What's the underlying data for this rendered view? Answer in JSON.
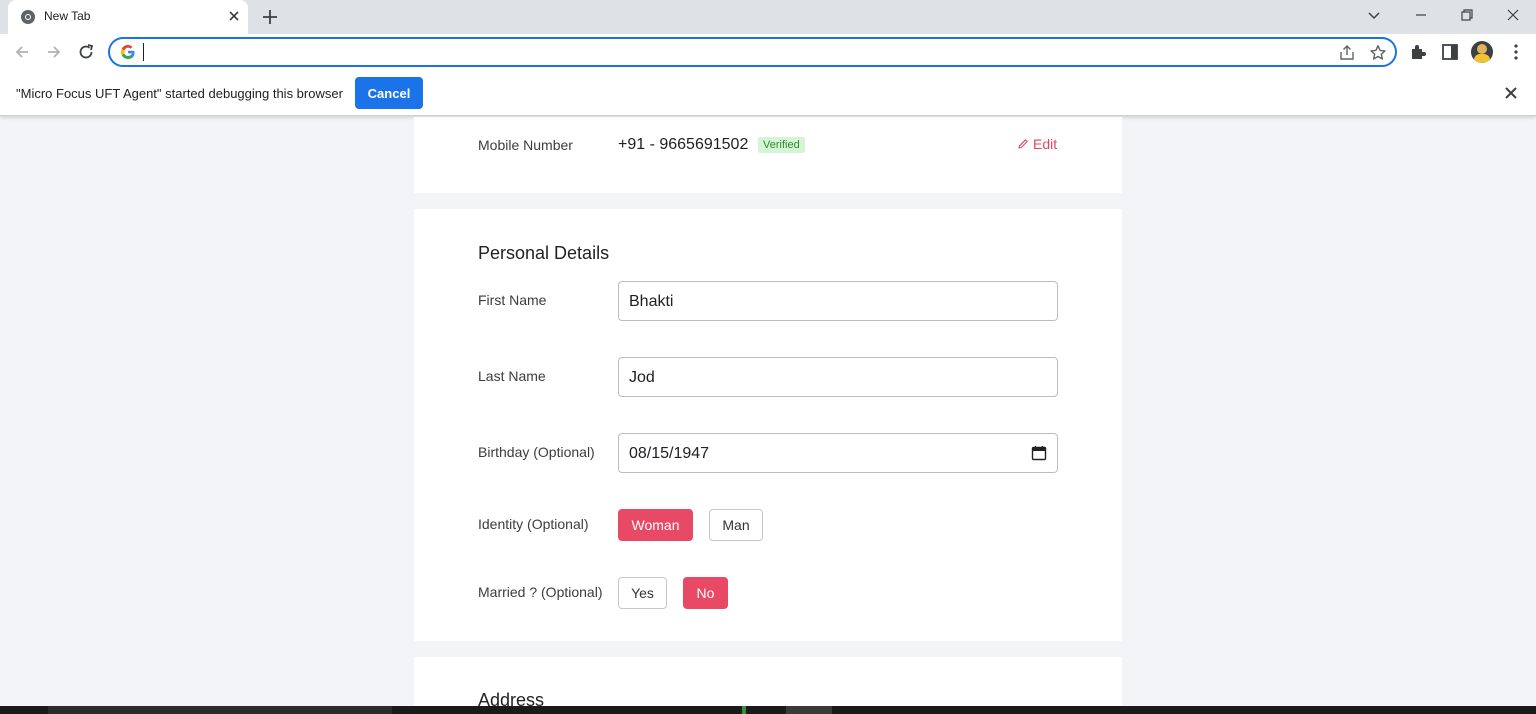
{
  "browser": {
    "tab_title": "New Tab",
    "omnibox_value": "",
    "infobar_message": "\"Micro Focus UFT Agent\" started debugging this browser",
    "infobar_cancel": "Cancel"
  },
  "contact": {
    "mobile_label": "Mobile Number",
    "mobile_value": "+91 - 9665691502",
    "verified_badge": "Verified",
    "edit_label": "Edit"
  },
  "personal": {
    "title": "Personal Details",
    "first_name_label": "First Name",
    "first_name_value": "Bhakti",
    "last_name_label": "Last Name",
    "last_name_value": "Jod",
    "birthday_label": "Birthday (Optional)",
    "birthday_value": "08/15/1947",
    "identity_label": "Identity (Optional)",
    "identity_options": [
      "Woman",
      "Man"
    ],
    "identity_selected": "Woman",
    "married_label": "Married ? (Optional)",
    "married_options": [
      "Yes",
      "No"
    ],
    "married_selected": "No"
  },
  "address": {
    "title": "Address"
  },
  "colors": {
    "accent": "#e84a65",
    "chrome_blue": "#1a73e8",
    "verified_bg": "#d6f5d6"
  }
}
